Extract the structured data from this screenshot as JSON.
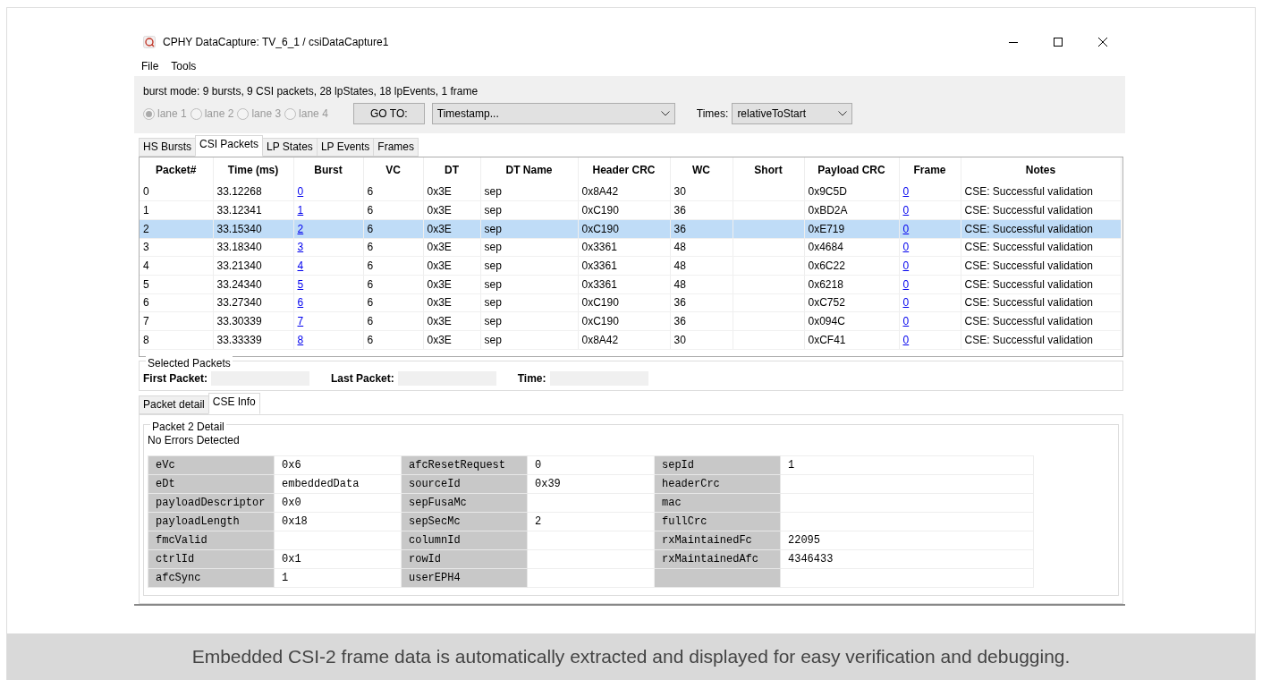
{
  "window": {
    "title": "CPHY DataCapture: TV_6_1 / csiDataCapture1"
  },
  "menu": [
    "File",
    "Tools"
  ],
  "summary": "burst mode: 9 bursts, 9 CSI packets, 28 lpStates, 18 lpEvents, 1 frame",
  "lanes": [
    {
      "label": "lane 1",
      "selected": true,
      "disabled": true
    },
    {
      "label": "lane 2",
      "selected": false,
      "disabled": true
    },
    {
      "label": "lane 3",
      "selected": false,
      "disabled": true
    },
    {
      "label": "lane 4",
      "selected": false,
      "disabled": true
    }
  ],
  "goto_button": "GO TO:",
  "goto_select": {
    "value": "Timestamp..."
  },
  "times": {
    "label": "Times:",
    "value": "relativeToStart"
  },
  "tabs": [
    {
      "label": "HS Bursts",
      "selected": false
    },
    {
      "label": "CSI Packets",
      "selected": true
    },
    {
      "label": "LP States",
      "selected": false
    },
    {
      "label": "LP Events",
      "selected": false
    },
    {
      "label": "Frames",
      "selected": false
    }
  ],
  "table": {
    "columns": [
      {
        "label": "Packet#",
        "kind": "text"
      },
      {
        "label": "Time (ms)",
        "kind": "text"
      },
      {
        "label": "Burst",
        "kind": "link"
      },
      {
        "label": "VC",
        "kind": "text"
      },
      {
        "label": "DT",
        "kind": "text"
      },
      {
        "label": "DT Name",
        "kind": "text"
      },
      {
        "label": "Header CRC",
        "kind": "text"
      },
      {
        "label": "WC",
        "kind": "text"
      },
      {
        "label": "Short"
      },
      {
        "label": "Payload CRC",
        "kind": "text"
      },
      {
        "label": "Frame",
        "kind": "link"
      },
      {
        "label": "Notes",
        "kind": "text"
      }
    ],
    "rows": [
      {
        "selected": false,
        "cells": [
          "0",
          "33.12268",
          "0",
          "6",
          "0x3E",
          "sep",
          "0x8A42",
          "30",
          null,
          "0x9C5D",
          "0",
          "CSE: Successful validation"
        ]
      },
      {
        "selected": false,
        "cells": [
          "1",
          "33.12341",
          "1",
          "6",
          "0x3E",
          "sep",
          "0xC190",
          "36",
          null,
          "0xBD2A",
          "0",
          "CSE: Successful validation"
        ]
      },
      {
        "selected": true,
        "cells": [
          "2",
          "33.15340",
          "2",
          "6",
          "0x3E",
          "sep",
          "0xC190",
          "36",
          null,
          "0xE719",
          "0",
          "CSE: Successful validation"
        ]
      },
      {
        "selected": false,
        "cells": [
          "3",
          "33.18340",
          "3",
          "6",
          "0x3E",
          "sep",
          "0x3361",
          "48",
          null,
          "0x4684",
          "0",
          "CSE: Successful validation"
        ]
      },
      {
        "selected": false,
        "cells": [
          "4",
          "33.21340",
          "4",
          "6",
          "0x3E",
          "sep",
          "0x3361",
          "48",
          null,
          "0x6C22",
          "0",
          "CSE: Successful validation"
        ]
      },
      {
        "selected": false,
        "cells": [
          "5",
          "33.24340",
          "5",
          "6",
          "0x3E",
          "sep",
          "0x3361",
          "48",
          null,
          "0x6218",
          "0",
          "CSE: Successful validation"
        ]
      },
      {
        "selected": false,
        "cells": [
          "6",
          "33.27340",
          "6",
          "6",
          "0x3E",
          "sep",
          "0xC190",
          "36",
          null,
          "0xC752",
          "0",
          "CSE: Successful validation"
        ]
      },
      {
        "selected": false,
        "cells": [
          "7",
          "33.30339",
          "7",
          "6",
          "0x3E",
          "sep",
          "0xC190",
          "36",
          null,
          "0x094C",
          "0",
          "CSE: Successful validation"
        ]
      },
      {
        "selected": false,
        "cells": [
          "8",
          "33.33339",
          "8",
          "6",
          "0x3E",
          "sep",
          "0x8A42",
          "30",
          null,
          "0xCF41",
          "0",
          "CSE: Successful validation"
        ]
      }
    ]
  },
  "selected_packets": {
    "title": "Selected Packets",
    "fields": [
      {
        "label": "First Packet:"
      },
      {
        "label": "Last Packet:"
      },
      {
        "label": "Time:"
      }
    ]
  },
  "detail_tabs": [
    {
      "label": "Packet detail",
      "selected": false
    },
    {
      "label": "CSE Info",
      "selected": true
    }
  ],
  "detail": {
    "title": "Packet 2 Detail",
    "status": "No Errors Detected",
    "columns": [
      [
        {
          "key": "eVc",
          "value": "0x6"
        },
        {
          "key": "eDt",
          "value": "embeddedData"
        },
        {
          "key": "payloadDescriptor",
          "value": "0x0"
        },
        {
          "key": "payloadLength",
          "value": "0x18"
        },
        {
          "key": "fmcValid"
        },
        {
          "key": "ctrlId",
          "value": "0x1"
        },
        {
          "key": "afcSync",
          "value": "1"
        }
      ],
      [
        {
          "key": "afcResetRequest",
          "value": "0"
        },
        {
          "key": "sourceId",
          "value": "0x39"
        },
        {
          "key": "sepFusaMc"
        },
        {
          "key": "sepSecMc",
          "value": "2"
        },
        {
          "key": "columnId"
        },
        {
          "key": "rowId"
        },
        {
          "key": "userEPH4"
        }
      ],
      [
        {
          "key": "sepId",
          "value": "1"
        },
        {
          "key": "headerCrc"
        },
        {
          "key": "mac"
        },
        {
          "key": "fullCrc"
        },
        {
          "key": "rxMaintainedFc",
          "value": "22095"
        },
        {
          "key": "rxMaintainedAfc",
          "value": "4346433"
        }
      ]
    ]
  },
  "caption": "Embedded CSI-2 frame data is automatically extracted and displayed for easy verification and debugging."
}
